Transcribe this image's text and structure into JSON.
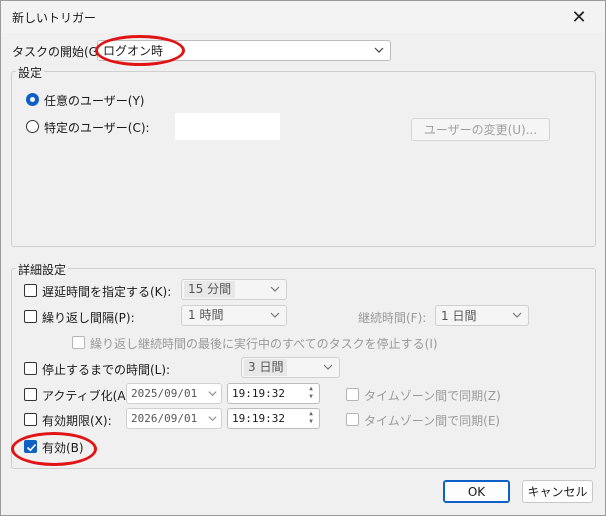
{
  "dialog": {
    "title": "新しいトリガー",
    "close_glyph": "✕"
  },
  "start": {
    "label": "タスクの開始(G):",
    "value": "ログオン時"
  },
  "settings": {
    "title": "設定",
    "any_user": "任意のユーザー(Y)",
    "specific_user": "特定のユーザー(C):",
    "change_user_button": "ユーザーの変更(U)..."
  },
  "advanced": {
    "title": "詳細設定",
    "delay_label": "遅延時間を指定する(K):",
    "delay_value": "15 分間",
    "repeat_label": "繰り返し間隔(P):",
    "repeat_value": "1 時間",
    "duration_label": "継続時間(F):",
    "duration_value": "1 日間",
    "stop_all_label": "繰り返し継続時間の最後に実行中のすべてのタスクを停止する(I)",
    "stop_after_label": "停止するまでの時間(L):",
    "stop_after_value": "3 日間",
    "activate_label": "アクティブ化(A):",
    "activate_date": "2025/09/01",
    "activate_time": "19:19:32",
    "activate_sync": "タイムゾーン間で同期(Z)",
    "expire_label": "有効期限(X):",
    "expire_date": "2026/09/01",
    "expire_time": "19:19:32",
    "expire_sync": "タイムゾーン間で同期(E)",
    "enabled_label": "有効(B)"
  },
  "buttons": {
    "ok": "OK",
    "cancel": "キャンセル"
  },
  "colors": {
    "accent": "#0f5fc4",
    "annotation": "#e01414"
  }
}
